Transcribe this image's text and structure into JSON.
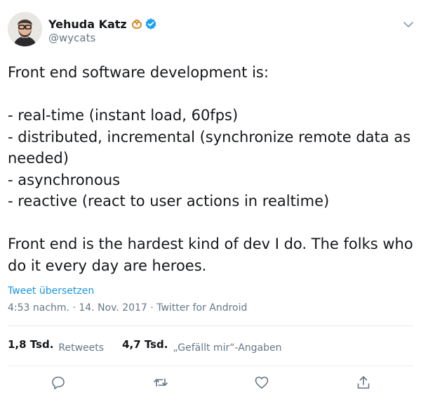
{
  "user": {
    "display_name": "Yehuda Katz",
    "handle": "@wycats",
    "verified": true,
    "name_emoji": "pretzel-icon"
  },
  "tweet": {
    "text": "Front end software development is:\n\n- real-time (instant load, 60fps)\n- distributed, incremental (synchronize remote data as needed)\n- asynchronous\n- reactive (react to user actions in realtime)\n\nFront end is the hardest kind of dev I do. The folks who do it every day are heroes.",
    "translate_label": "Tweet übersetzen",
    "time": "4:53 nachm.",
    "separator": " · ",
    "date": "14. Nov. 2017",
    "source": "Twitter for Android"
  },
  "stats": {
    "retweets_count": "1,8 Tsd.",
    "retweets_label": "Retweets",
    "likes_count": "4,7 Tsd.",
    "likes_label": "„Gefällt mir“-Angaben"
  },
  "actions": [
    "reply-icon",
    "retweet-icon",
    "like-icon",
    "share-icon"
  ],
  "colors": {
    "text": "#14171a",
    "secondary": "#657786",
    "link": "#1b95e0",
    "verified": "#1da1f2",
    "divider": "#e6ecf0"
  }
}
